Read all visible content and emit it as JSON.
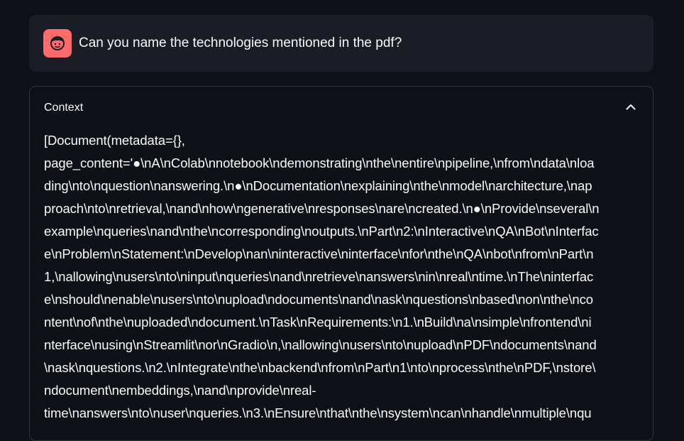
{
  "chat": {
    "user_message": "Can you name the technologies mentioned in the pdf?",
    "avatar_icon": "user-face-icon",
    "avatar_color": "#ff6b6b"
  },
  "context_expander": {
    "label": "Context",
    "toggle_icon": "chevron-up-icon",
    "lines": [
      "[Document(metadata={},",
      "page_content='●\\nA\\nColab\\nnotebook\\ndemonstrating\\nthe\\nentire\\npipeline,\\nfrom\\ndata\\nloa",
      "ding\\nto\\nquestion\\nanswering.\\n●\\nDocumentation\\nexplaining\\nthe\\nmodel\\narchitecture,\\nap",
      "proach\\nto\\nretrieval,\\nand\\nhow\\ngenerative\\nresponses\\nare\\ncreated.\\n●\\nProvide\\nseveral\\n",
      "example\\nqueries\\nand\\nthe\\ncorresponding\\noutputs.\\nPart\\n2:\\nInteractive\\nQA\\nBot\\nInterfac",
      "e\\nProblem\\nStatement:\\nDevelop\\nan\\ninteractive\\ninterface\\nfor\\nthe\\nQA\\nbot\\nfrom\\nPart\\n",
      "1,\\nallowing\\nusers\\nto\\ninput\\nqueries\\nand\\nretrieve\\nanswers\\nin\\nreal\\ntime.\\nThe\\ninterfac",
      "e\\nshould\\nenable\\nusers\\nto\\nupload\\ndocuments\\nand\\nask\\nquestions\\nbased\\non\\nthe\\nco",
      "ntent\\nof\\nthe\\nuploaded\\ndocument.\\nTask\\nRequirements:\\n1.\\nBuild\\na\\nsimple\\nfrontend\\ni",
      "nterface\\nusing\\nStreamlit\\nor\\nGradio\\n,\\nallowing\\nusers\\nto\\nupload\\nPDF\\ndocuments\\nand",
      "\\nask\\nquestions.\\n2.\\nIntegrate\\nthe\\nbackend\\nfrom\\nPart\\n1\\nto\\nprocess\\nthe\\nPDF,\\nstore\\",
      "ndocument\\nembeddings,\\nand\\nprovide\\nreal-",
      "time\\nanswers\\nto\\nuser\\nqueries.\\n3.\\nEnsure\\nthat\\nthe\\nsystem\\ncan\\nhandle\\nmultiple\\nqu"
    ]
  }
}
